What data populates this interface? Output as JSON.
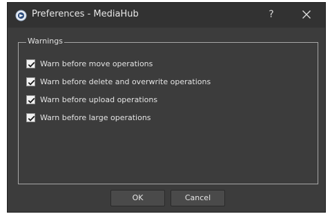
{
  "window": {
    "title": "Preferences - MediaHub",
    "help_label": "?",
    "close_icon": "close-icon",
    "app_icon": "mediahub-app-icon"
  },
  "warnings": {
    "group_title": "Warnings",
    "options": [
      {
        "label": "Warn before move operations",
        "checked": true
      },
      {
        "label": "Warn before delete and overwrite operations",
        "checked": true
      },
      {
        "label": "Warn before upload operations",
        "checked": true
      },
      {
        "label": "Warn before large operations",
        "checked": true
      }
    ]
  },
  "buttons": {
    "ok": "OK",
    "cancel": "Cancel"
  },
  "colors": {
    "window_bg": "#3c3c3c",
    "titlebar_bg": "#323232",
    "text": "#e4e4e4"
  }
}
